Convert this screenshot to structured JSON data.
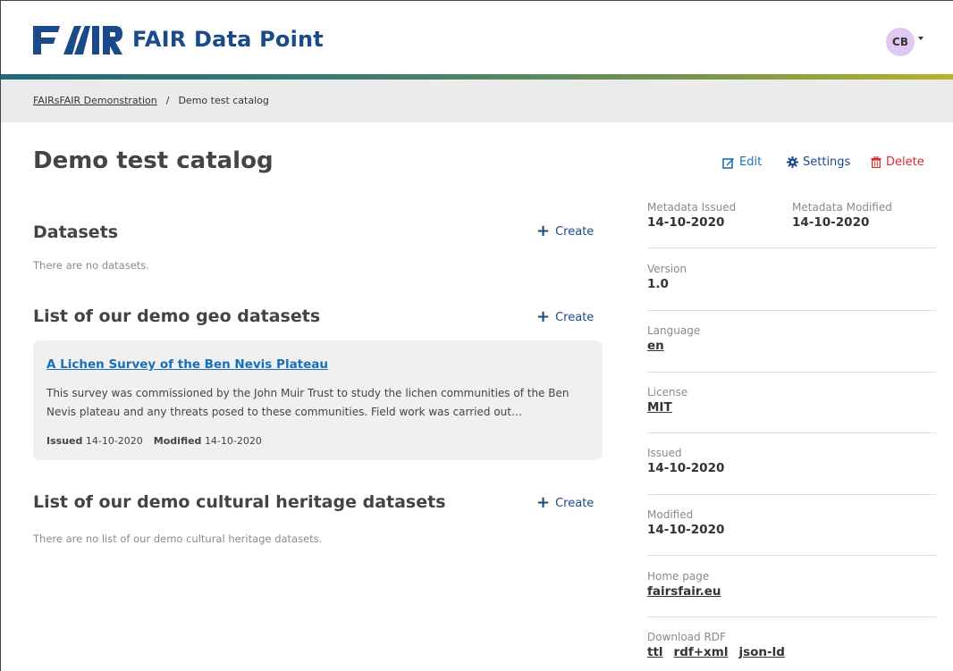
{
  "header": {
    "logo_text": "FAIR",
    "app_title": "FAIR Data Point",
    "user_initials": "CB"
  },
  "breadcrumb": {
    "parent": "FAIRsFAIR Demonstration",
    "separator": "/",
    "current": "Demo test catalog"
  },
  "page": {
    "title": "Demo test catalog",
    "actions": {
      "edit": "Edit",
      "settings": "Settings",
      "delete": "Delete"
    }
  },
  "sections": [
    {
      "title": "Datasets",
      "create_label": "Create",
      "empty_text": "There are no datasets."
    },
    {
      "title": "List of our demo geo datasets",
      "create_label": "Create",
      "items": [
        {
          "title": "A Lichen Survey of the Ben Nevis Plateau",
          "description": "This survey was commissioned by the John Muir Trust to study the lichen communities of the Ben Nevis plateau and any threats posed to these communities. Field work was carried out…",
          "issued_label": "Issued",
          "issued": "14-10-2020",
          "modified_label": "Modified",
          "modified": "14-10-2020"
        }
      ]
    },
    {
      "title": "List of our demo cultural heritage datasets",
      "create_label": "Create",
      "empty_text": "There are no list of our demo cultural heritage datasets."
    }
  ],
  "metadata": {
    "metadata_issued_label": "Metadata Issued",
    "metadata_issued": "14-10-2020",
    "metadata_modified_label": "Metadata Modified",
    "metadata_modified": "14-10-2020",
    "version_label": "Version",
    "version": "1.0",
    "language_label": "Language",
    "language": "en",
    "license_label": "License",
    "license": "MIT",
    "issued_label": "Issued",
    "issued": "14-10-2020",
    "modified_label": "Modified",
    "modified": "14-10-2020",
    "homepage_label": "Home page",
    "homepage": "fairsfair.eu",
    "download_label": "Download RDF",
    "download_formats": [
      "ttl",
      "rdf+xml",
      "json-ld"
    ]
  },
  "colors": {
    "brand": "#1a4a8a",
    "link": "#1a6fb8",
    "danger": "#d42b2b",
    "avatar_bg": "#e0c8f2"
  }
}
